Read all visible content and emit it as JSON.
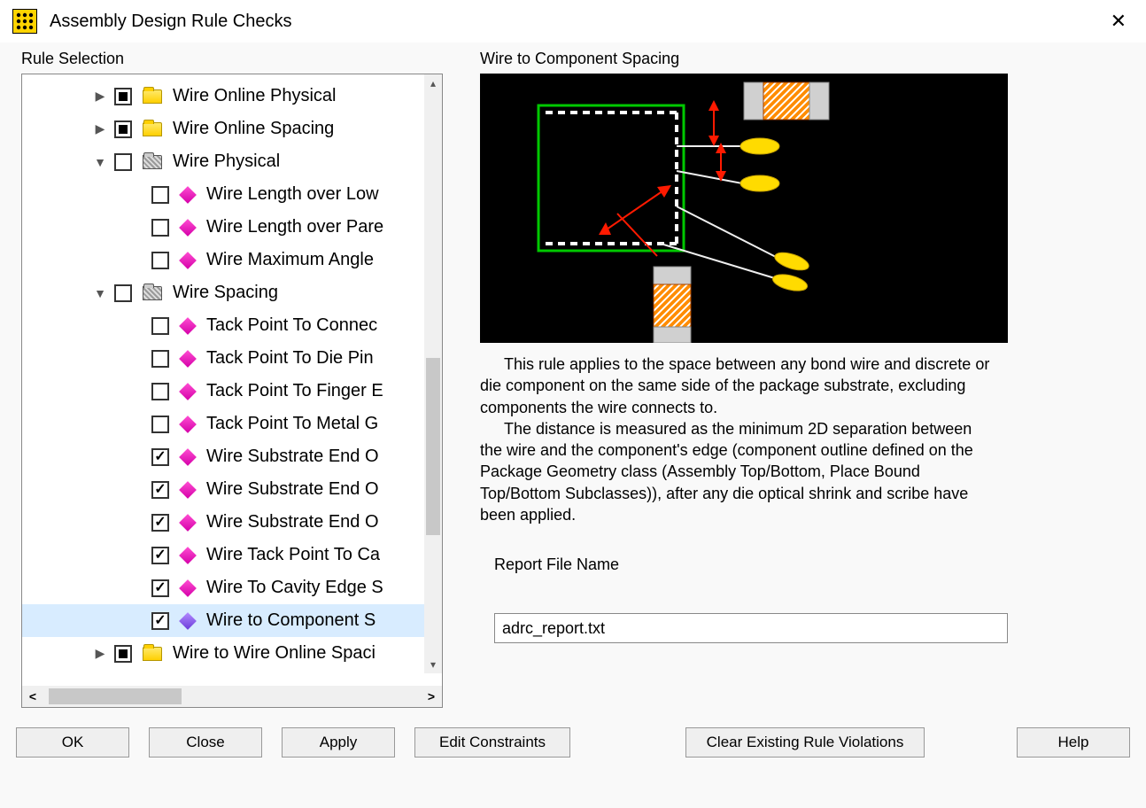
{
  "window": {
    "title": "Assembly Design Rule Checks"
  },
  "left": {
    "label": "Rule Selection",
    "tree": [
      {
        "level": 0,
        "chev": "right",
        "chkState": "mixed",
        "icon": "folder-closed",
        "label": "Wire Online Physical"
      },
      {
        "level": 0,
        "chev": "right",
        "chkState": "mixed",
        "icon": "folder-closed",
        "label": "Wire Online Spacing"
      },
      {
        "level": 0,
        "chev": "down",
        "chkState": "off",
        "icon": "folder-open",
        "label": "Wire Physical"
      },
      {
        "level": 1,
        "chev": "",
        "chkState": "off",
        "icon": "d-pink",
        "label": "Wire Length over Low"
      },
      {
        "level": 1,
        "chev": "",
        "chkState": "off",
        "icon": "d-pink",
        "label": "Wire Length over Pare"
      },
      {
        "level": 1,
        "chev": "",
        "chkState": "off",
        "icon": "d-pink",
        "label": "Wire Maximum Angle"
      },
      {
        "level": 0,
        "chev": "down",
        "chkState": "off",
        "icon": "folder-open",
        "label": "Wire Spacing"
      },
      {
        "level": 1,
        "chev": "",
        "chkState": "off",
        "icon": "d-pink",
        "label": "Tack Point To Connec"
      },
      {
        "level": 1,
        "chev": "",
        "chkState": "off",
        "icon": "d-pink",
        "label": "Tack Point To Die Pin"
      },
      {
        "level": 1,
        "chev": "",
        "chkState": "off",
        "icon": "d-pink",
        "label": "Tack Point To Finger E"
      },
      {
        "level": 1,
        "chev": "",
        "chkState": "off",
        "icon": "d-pink",
        "label": "Tack Point To Metal G"
      },
      {
        "level": 1,
        "chev": "",
        "chkState": "on",
        "icon": "d-pink",
        "label": "Wire Substrate End O"
      },
      {
        "level": 1,
        "chev": "",
        "chkState": "on",
        "icon": "d-pink",
        "label": "Wire Substrate End O"
      },
      {
        "level": 1,
        "chev": "",
        "chkState": "on",
        "icon": "d-pink",
        "label": "Wire Substrate End O"
      },
      {
        "level": 1,
        "chev": "",
        "chkState": "on",
        "icon": "d-pink",
        "label": "Wire Tack Point To Ca"
      },
      {
        "level": 1,
        "chev": "",
        "chkState": "on",
        "icon": "d-pink",
        "label": "Wire To Cavity Edge S"
      },
      {
        "level": 1,
        "chev": "",
        "chkState": "on",
        "icon": "d-purple",
        "label": "Wire to Component S",
        "selected": true
      },
      {
        "level": 0,
        "chev": "right",
        "chkState": "mixed",
        "icon": "folder-closed",
        "label": "Wire to Wire Online Spaci"
      }
    ]
  },
  "right": {
    "title": "Wire to Component Spacing",
    "desc_p1": "This rule applies to the space between any bond wire and discrete or die component on the same side of the package substrate, excluding components the wire connects to.",
    "desc_p2": "The distance is measured as the minimum 2D separation between the wire and the component's edge (component outline defined on  the Package Geometry class (Assembly Top/Bottom, Place Bound Top/Bottom Subclasses)), after any die optical shrink and scribe have been applied.",
    "report_label": "Report File Name",
    "report_value": "adrc_report.txt"
  },
  "buttons": {
    "ok": "OK",
    "close": "Close",
    "apply": "Apply",
    "edit": "Edit Constraints",
    "clear": "Clear Existing Rule Violations",
    "help": "Help"
  }
}
